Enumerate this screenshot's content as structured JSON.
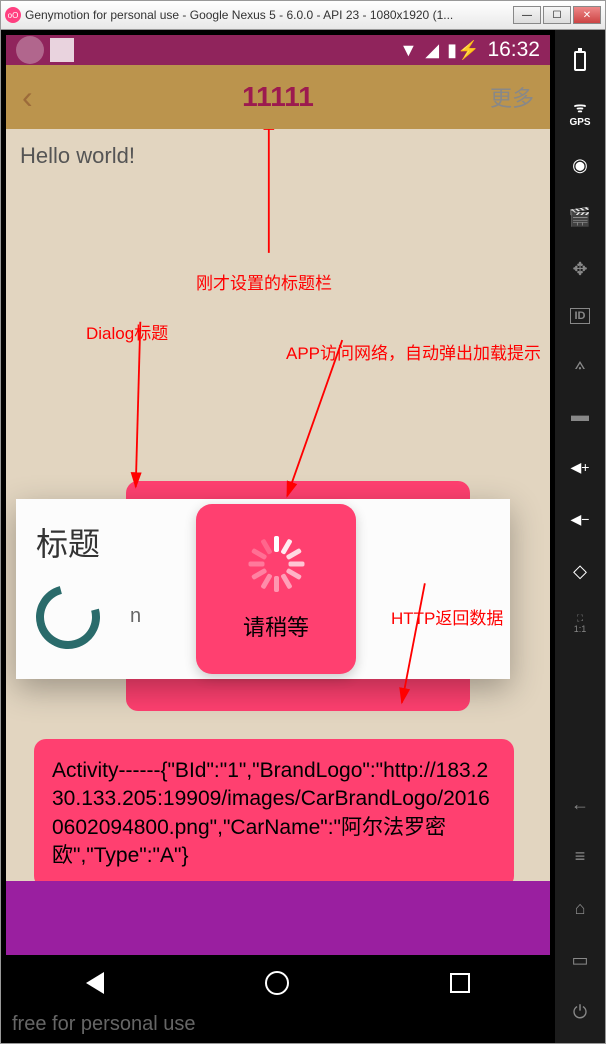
{
  "window": {
    "title": "Genymotion for personal use - Google Nexus 5 - 6.0.0 - API 23 - 1080x1920 (1...",
    "icon_label": "oO"
  },
  "status": {
    "time": "16:32"
  },
  "header": {
    "title": "11111",
    "more": "更多"
  },
  "content": {
    "hello": "Hello world!"
  },
  "dialog": {
    "title": "标题",
    "cutoff": "n"
  },
  "loading": {
    "text": "请稍等"
  },
  "http": {
    "text": "Activity------{\"BId\":\"1\",\"BrandLogo\":\"http://183.230.133.205:19909/images/CarBrandLogo/20160602094800.png\",\"CarName\":\"阿尔法罗密欧\",\"Type\":\"A\"}"
  },
  "watermark": "free for personal use",
  "annotations": {
    "title_bar": "刚才设置的标题栏",
    "dialog_title": "Dialog标题",
    "loading_desc": "APP访问网络，自动弹出加载提示",
    "http_data": "HTTP返回数据"
  },
  "sidebar": {
    "gps": "GPS",
    "id": "ID",
    "ratio": "1:1"
  },
  "vol_plus": "+",
  "vol_minus": "−"
}
